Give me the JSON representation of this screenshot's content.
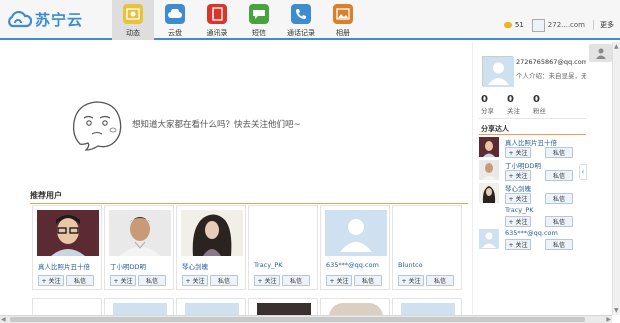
{
  "header": {
    "logo_text": "苏宁云",
    "nav": [
      {
        "label": "动态",
        "icon": "photo-icon",
        "color": "#e8c23b",
        "active": true
      },
      {
        "label": "云盘",
        "icon": "cloud-icon",
        "color": "#3d8ccf"
      },
      {
        "label": "通讯录",
        "icon": "contacts-icon",
        "color": "#d9362b"
      },
      {
        "label": "短信",
        "icon": "sms-icon",
        "color": "#48a33d"
      },
      {
        "label": "通话记录",
        "icon": "call-log-icon",
        "color": "#3d8ccf"
      },
      {
        "label": "相册",
        "icon": "album-icon",
        "color": "#d9802b"
      }
    ],
    "coin_count": "51",
    "user": "272....com",
    "more": "更多"
  },
  "main": {
    "empty_message": "想知道大家都在看什么吗？快去关注他们吧~",
    "recommended_title": "推荐用户",
    "follow_label": "+ 关注",
    "message_label": "私信",
    "cards": [
      {
        "name": "真人比照片丑十倍",
        "photo": "user-photo-glasses"
      },
      {
        "name": "丁小明DD明",
        "photo": "user-photo-ronaldo"
      },
      {
        "name": "琴心剑魄",
        "photo": "user-photo-swordsman"
      },
      {
        "name": "Tracy_PK",
        "photo": "blank"
      },
      {
        "name": "635***@qq.com",
        "photo": "default-avatar"
      },
      {
        "name": "Bluntco",
        "photo": "blank"
      }
    ]
  },
  "profile": {
    "email": "2726765867@qq.com",
    "intro": "个人介绍：未自显旻，无介",
    "stats": [
      {
        "num": "0",
        "label": "分享"
      },
      {
        "num": "0",
        "label": "关注"
      },
      {
        "num": "0",
        "label": "粉丝"
      }
    ],
    "share_title": "分享达人",
    "sharers": [
      {
        "name": "真人比照片丑十倍",
        "photo": "user-photo-glasses"
      },
      {
        "name": "丁小明DD明",
        "photo": "user-photo-ronaldo"
      },
      {
        "name": "琴心剑魄",
        "photo": "user-photo-swordsman"
      },
      {
        "name": "Tracy_PK",
        "photo": "blank"
      },
      {
        "name": "635***@qq.com",
        "photo": "default-avatar"
      }
    ]
  }
}
